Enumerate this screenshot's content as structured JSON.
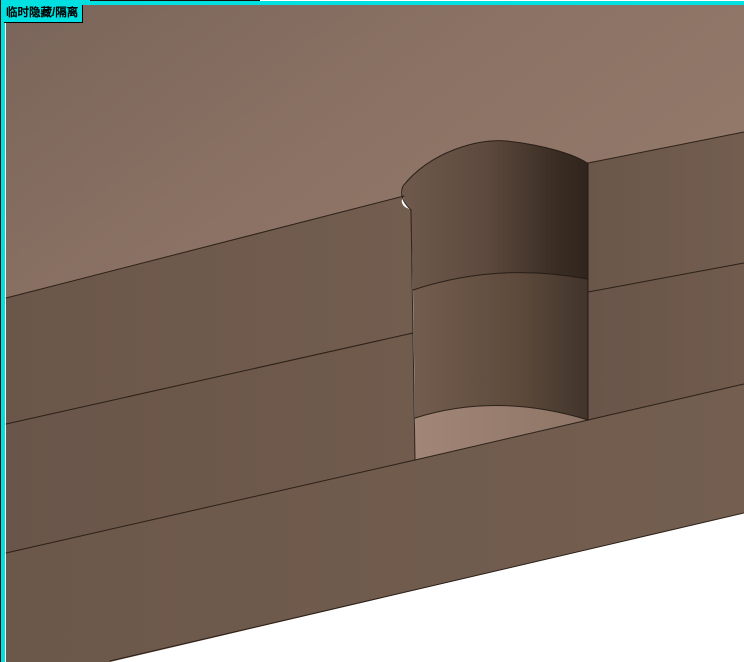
{
  "overlay": {
    "temp_hide_isolate_label": "临时隐藏/隔离"
  },
  "colors": {
    "viewport_border_accent": "#00e0e0",
    "chip_background": "#00e0e0",
    "chip_text": "#000000",
    "scene_background": "#ffffff",
    "part_top_face": "#8d7466",
    "part_front_face": "#6e5a4c",
    "hole_wall_shadow": "#342921",
    "hole_floor": "#9b8173",
    "edge_line": "#20160f"
  }
}
